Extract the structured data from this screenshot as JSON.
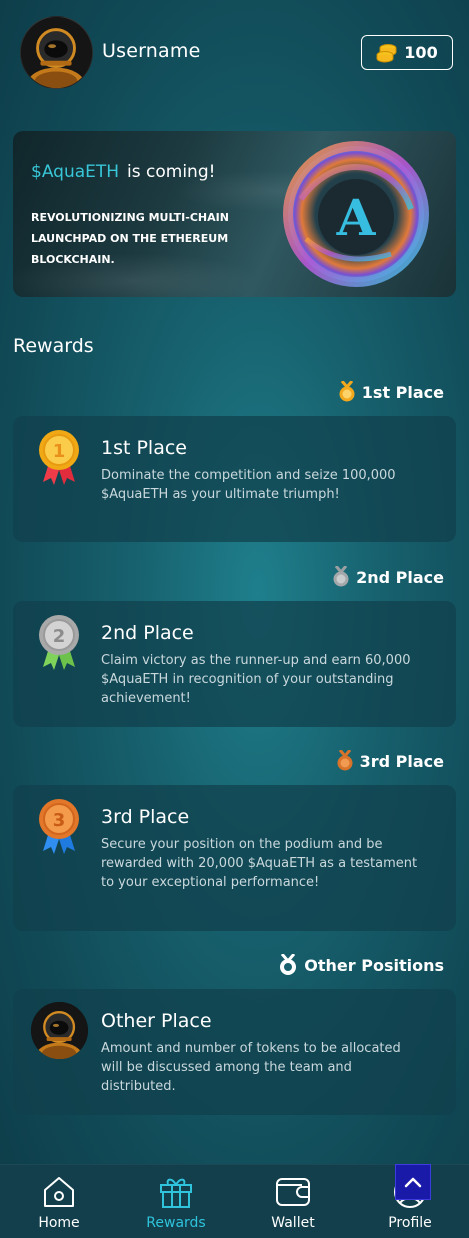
{
  "header": {
    "username": "Username",
    "coin_count": "100",
    "coin_icon": "coin-stack-icon"
  },
  "banner": {
    "ticker": "$AquaETH",
    "title_rest": "is coming!",
    "subtitle": "REVOLUTIONIZING MULTI-CHAIN LAUNCHPAD ON THE ETHEREUM BLOCKCHAIN.",
    "logo_letter": "A"
  },
  "rewards": {
    "section_title": "Rewards",
    "items": [
      {
        "label": "1st Place",
        "medal_number": "1",
        "title": "1st Place",
        "description": "Dominate the competition and seize 100,000 $AquaETH as your ultimate triumph!"
      },
      {
        "label": "2nd Place",
        "medal_number": "2",
        "title": "2nd Place",
        "description": "Claim victory as the runner-up and earn 60,000 $AquaETH in recognition of your outstanding achievement!"
      },
      {
        "label": "3rd Place",
        "medal_number": "3",
        "title": "3rd Place",
        "description": "Secure your position on the podium and be rewarded with 20,000 $AquaETH as a testament to your exceptional performance!"
      },
      {
        "label": "Other Positions",
        "title": "Other Place",
        "description": "Amount and number of tokens to be allocated will be discussed among the team and distributed."
      }
    ]
  },
  "nav": {
    "items": [
      {
        "label": "Home",
        "icon": "home-icon"
      },
      {
        "label": "Rewards",
        "icon": "gift-icon"
      },
      {
        "label": "Wallet",
        "icon": "wallet-icon"
      },
      {
        "label": "Profile",
        "icon": "profile-icon"
      }
    ],
    "active": "Rewards"
  },
  "colors": {
    "accent": "#2fc3dc",
    "gold": "#f2a81d",
    "silver": "#b5b5b5",
    "bronze": "#e0782b",
    "scroll_button": "#1a1aa8"
  }
}
